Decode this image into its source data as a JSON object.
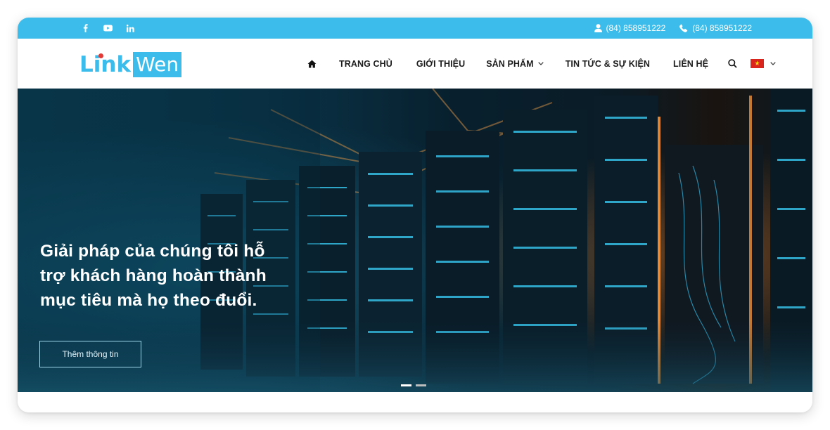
{
  "topbar": {
    "social": [
      {
        "name": "facebook-icon"
      },
      {
        "name": "youtube-icon"
      },
      {
        "name": "linkedin-icon"
      }
    ],
    "contacts": [
      {
        "icon": "user-icon",
        "text": "(84) 858951222"
      },
      {
        "icon": "phone-icon",
        "text": "(84) 858951222"
      }
    ],
    "background": "#3cbcea"
  },
  "logo": {
    "part1": "Link",
    "part2": "Wen"
  },
  "nav": {
    "items": [
      "TRANG CHỦ",
      "GIỚI THIỆU",
      "SẢN PHẨM",
      "TIN TỨC & SỰ KIỆN",
      "LIÊN HỆ"
    ],
    "home_icon": "home-icon",
    "search_icon": "search-icon",
    "language_flag": "vietnam-flag-icon"
  },
  "hero": {
    "title_lines": [
      "Giải pháp của chúng tôi hỗ",
      "trợ khách hàng hoàn thành",
      "mục tiêu mà họ theo đuổi."
    ],
    "cta": "Thêm thông tin",
    "slides_total": 2,
    "slide_active": 1
  }
}
